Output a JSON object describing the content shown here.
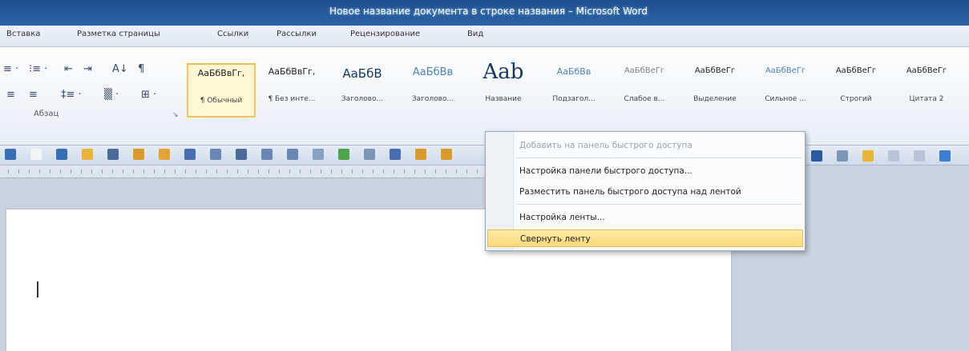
{
  "window": {
    "title": "Новое название документа в строке названия – Microsoft Word"
  },
  "ribbon_tabs": [
    "Вставка",
    "Разметка страницы",
    "Ссылки",
    "Рассылки",
    "Рецензирование",
    "Вид"
  ],
  "paragraph_group": {
    "label": "Абзац",
    "row1": [
      "≡ ·",
      "⁝≡ ·",
      "⇤",
      "⇥",
      "A↓",
      "¶"
    ],
    "row2": [
      "≡",
      "≡",
      "‡≡ ·",
      "▒ ·",
      "⊞ ·"
    ]
  },
  "styles": [
    {
      "preview": "АаБбВвГг,",
      "name": "¶ Обычный",
      "selected": true,
      "color": "#1f1f1f",
      "size": 11
    },
    {
      "preview": "АаБбВвГг,",
      "name": "¶ Без инте...",
      "selected": false,
      "color": "#1f1f1f",
      "size": 11
    },
    {
      "preview": "АаБбВ",
      "name": "Заголово...",
      "selected": false,
      "color": "#17365d",
      "size": 15
    },
    {
      "preview": "АаБбВв",
      "name": "Заголово...",
      "selected": false,
      "color": "#4f81bd",
      "size": 13
    },
    {
      "preview": "Aab",
      "name": "Название",
      "selected": false,
      "color": "#17365d",
      "size": 26
    },
    {
      "preview": "АаБбВв",
      "name": "Подзагол...",
      "selected": false,
      "color": "#4f81bd",
      "size": 11
    },
    {
      "preview": "АаБбВеГг",
      "name": "Слабое в...",
      "selected": false,
      "color": "#808080",
      "size": 10
    },
    {
      "preview": "АаБбВеГг",
      "name": "Выделение",
      "selected": false,
      "color": "#1f1f1f",
      "size": 10
    },
    {
      "preview": "АаБбВеГг",
      "name": "Сильное ...",
      "selected": false,
      "color": "#4f81bd",
      "size": 10
    },
    {
      "preview": "АаБбВеГг",
      "name": "Строгий",
      "selected": false,
      "color": "#1f1f1f",
      "size": 10
    },
    {
      "preview": "АаБбВеГг",
      "name": "Цитата 2",
      "selected": false,
      "color": "#1f1f1f",
      "size": 10
    }
  ],
  "context_menu": {
    "items": [
      {
        "label": "Добавить на панель быстрого доступа",
        "state": "disabled"
      },
      {
        "label": "Настройка панели быстрого доступа...",
        "state": "normal"
      },
      {
        "label": "Разместить панель быстрого доступа над лентой",
        "state": "normal"
      },
      {
        "label": "Настройка ленты...",
        "state": "normal"
      },
      {
        "label": "Свернуть ленту",
        "state": "highlighted"
      }
    ]
  },
  "toolbar_icons": [
    "undo-arrow-icon",
    "new-doc-icon",
    "save-icon",
    "open-folder-icon",
    "align-icon",
    "picture-icon",
    "chart-icon",
    "frame-icon",
    "table-icon",
    "border-icon",
    "plus-icon",
    "line-icon",
    "shape-icon",
    "circle-icon",
    "grid-icon",
    "table-grid-icon",
    "color-icon",
    "fill-icon"
  ],
  "right_toolbar_icons": [
    "text-box-icon",
    "frame-icon",
    "doc-icon",
    "line-icon",
    "arrow-icon",
    "image-icon"
  ]
}
